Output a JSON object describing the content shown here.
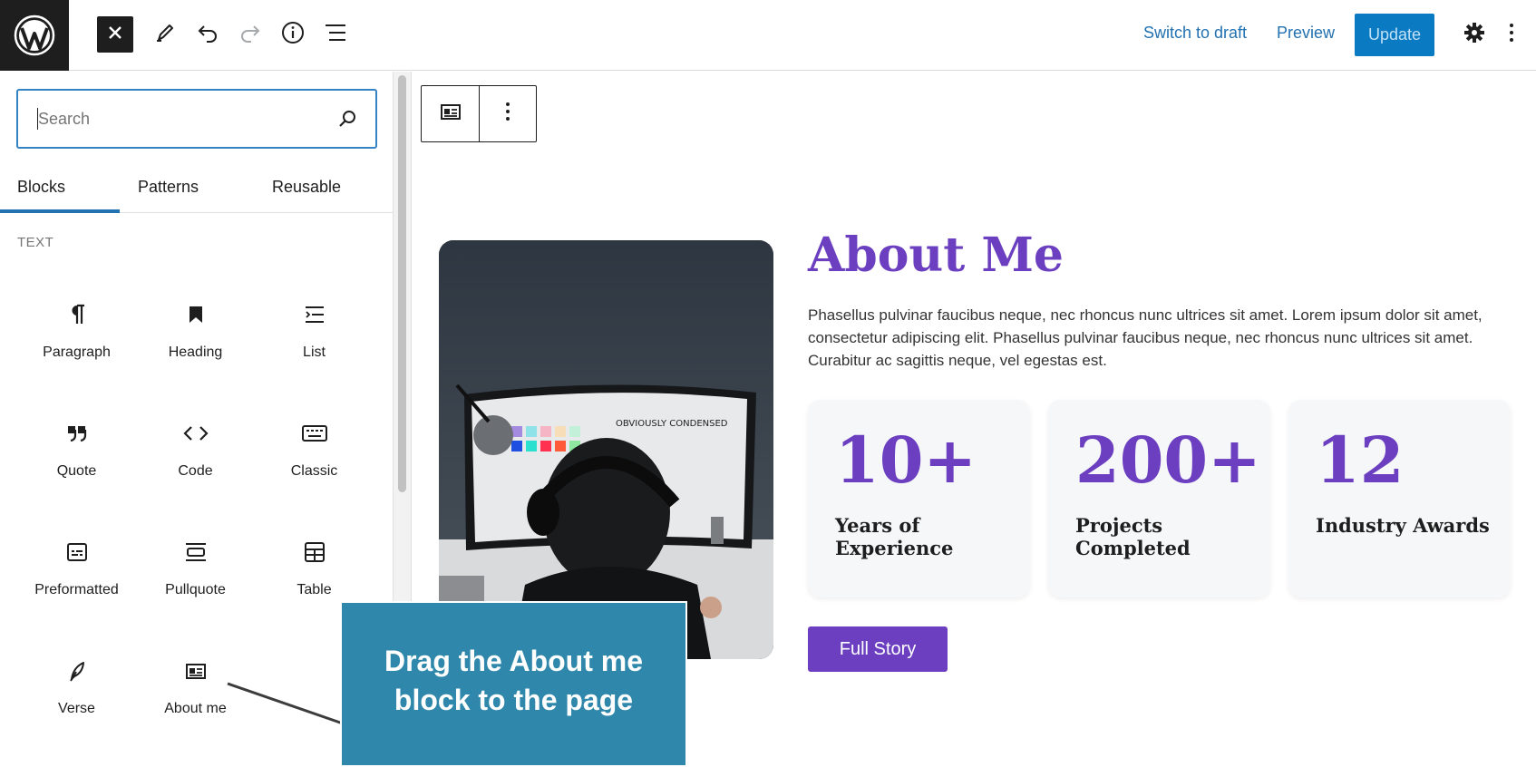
{
  "topbar": {
    "switch_to_draft": "Switch to draft",
    "preview": "Preview",
    "update": "Update"
  },
  "sidebar": {
    "search_placeholder": "Search",
    "tabs": [
      {
        "label": "Blocks",
        "active": true
      },
      {
        "label": "Patterns",
        "active": false
      },
      {
        "label": "Reusable",
        "active": false
      }
    ],
    "section_label": "TEXT",
    "blocks": [
      {
        "label": "Paragraph",
        "icon": "paragraph-icon"
      },
      {
        "label": "Heading",
        "icon": "heading-icon"
      },
      {
        "label": "List",
        "icon": "list-icon"
      },
      {
        "label": "Quote",
        "icon": "quote-icon"
      },
      {
        "label": "Code",
        "icon": "code-icon"
      },
      {
        "label": "Classic",
        "icon": "keyboard-icon"
      },
      {
        "label": "Preformatted",
        "icon": "preformatted-icon"
      },
      {
        "label": "Pullquote",
        "icon": "pullquote-icon"
      },
      {
        "label": "Table",
        "icon": "table-icon"
      },
      {
        "label": "Verse",
        "icon": "feather-icon"
      },
      {
        "label": "About me",
        "icon": "id-card-icon"
      }
    ]
  },
  "content": {
    "title": "About Me",
    "paragraph": "Phasellus pulvinar faucibus neque, nec rhoncus nunc ultrices sit amet. Lorem ipsum dolor sit amet, consectetur adipiscing elit. Phasellus pulvinar faucibus neque, nec rhoncus nunc ultrices sit amet. Curabitur ac sagittis neque, vel egestas est.",
    "stats": [
      {
        "number": "10+",
        "label": "Years of Experience"
      },
      {
        "number": "200+",
        "label": "Projects Completed"
      },
      {
        "number": "12",
        "label": "Industry Awards"
      }
    ],
    "button": "Full Story",
    "monitor_text": "OBVIOUSLY CONDENSED"
  },
  "callout": {
    "text": "Drag the About me block to the page"
  },
  "colors": {
    "accent": "#6b3fc0",
    "wp_blue": "#2271b1",
    "callout_bg": "#2f88ab"
  }
}
